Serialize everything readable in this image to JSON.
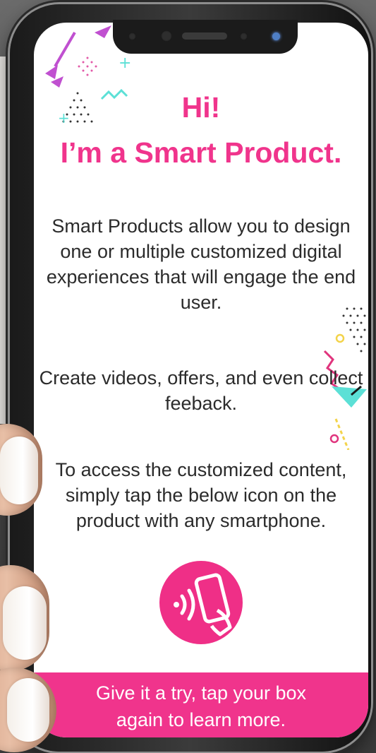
{
  "screen": {
    "headline_line1": "Hi!",
    "headline_line2": "I’m a Smart Product.",
    "paragraph1": "Smart Products allow you to design one or multiple customized digital experiences that will engage the end user.",
    "paragraph2": "Create videos, offers, and even collect feeback.",
    "paragraph3": "To access the customized content, simply tap the below icon on the product with any smartphone.",
    "tap_icon": "nfc-tap-phone-icon",
    "footer_line1": "Give it a try, tap your box",
    "footer_line2": "again to learn more."
  },
  "colors": {
    "accent": "#f0348c",
    "text": "#2b2b2b",
    "teal": "#5ce0d6",
    "purple": "#c050d0",
    "yellow": "#f3d34a"
  }
}
